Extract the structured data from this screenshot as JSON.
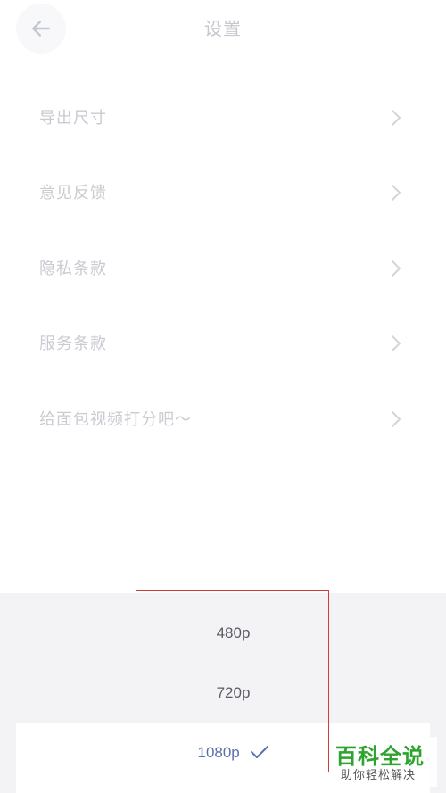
{
  "header": {
    "title": "设置"
  },
  "settings": {
    "items": [
      {
        "label": "导出尺寸"
      },
      {
        "label": "意见反馈"
      },
      {
        "label": "隐私条款"
      },
      {
        "label": "服务条款"
      },
      {
        "label": "给面包视频打分吧～"
      }
    ]
  },
  "resolution_sheet": {
    "options": [
      {
        "label": "480p"
      },
      {
        "label": "720p"
      },
      {
        "label": "1080p"
      }
    ],
    "selected": "1080p"
  },
  "watermark": {
    "main": "百科全说",
    "sub": "助你轻松解决"
  },
  "colors": {
    "background": "#ffffff",
    "muted_text": "#c9cbd1",
    "sheet_background": "#f3f3f5",
    "selected_accent": "#5b6fae",
    "highlight_border": "#d33a3a",
    "watermark_green": "#2ea32e"
  }
}
